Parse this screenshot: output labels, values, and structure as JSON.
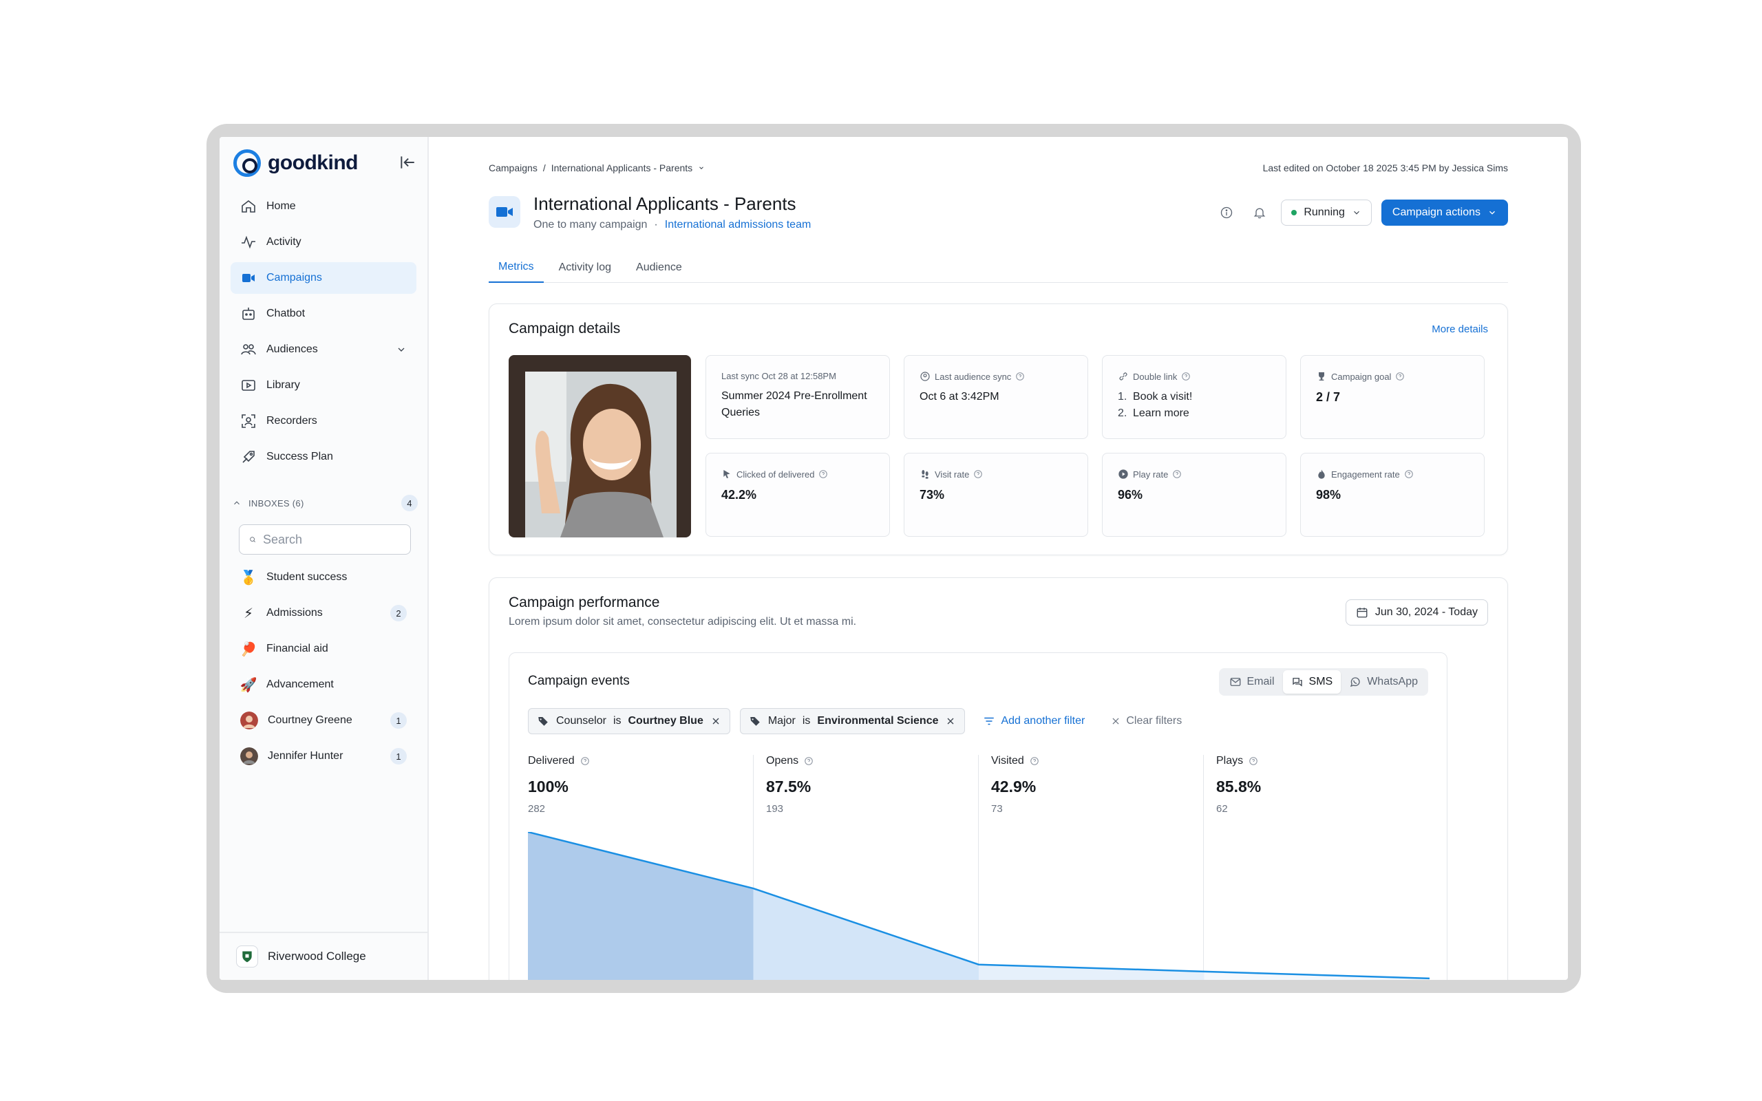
{
  "brand": {
    "name": "goodkind"
  },
  "sidebar": {
    "nav": [
      {
        "label": "Home",
        "icon": "home-icon"
      },
      {
        "label": "Activity",
        "icon": "activity-icon"
      },
      {
        "label": "Campaigns",
        "icon": "campaigns-icon",
        "active": true
      },
      {
        "label": "Chatbot",
        "icon": "chatbot-icon"
      },
      {
        "label": "Audiences",
        "icon": "audiences-icon",
        "expandable": true
      },
      {
        "label": "Library",
        "icon": "library-icon"
      },
      {
        "label": "Recorders",
        "icon": "recorders-icon"
      },
      {
        "label": "Success Plan",
        "icon": "success-plan-icon"
      }
    ],
    "inboxes_header": "INBOXES (6)",
    "inboxes_count": "4",
    "search_placeholder": "Search",
    "inboxes": [
      {
        "label": "Student success",
        "icon": "medal-icon",
        "count": ""
      },
      {
        "label": "Admissions",
        "icon": "lightning-icon",
        "count": "2"
      },
      {
        "label": "Financial aid",
        "icon": "ping-pong-icon",
        "count": ""
      },
      {
        "label": "Advancement",
        "icon": "rocket-icon",
        "count": ""
      },
      {
        "label": "Courtney Greene",
        "icon": "avatar",
        "count": "1"
      },
      {
        "label": "Jennifer Hunter",
        "icon": "avatar",
        "count": "1"
      }
    ],
    "org": "Riverwood College"
  },
  "breadcrumb": {
    "root": "Campaigns",
    "separator": "/",
    "current": "International Applicants - Parents"
  },
  "last_edited": "Last edited on October 18 2025 3:45 PM by Jessica Sims",
  "campaign": {
    "title": "International Applicants - Parents",
    "type": "One to many campaign",
    "separator": "·",
    "team": "International admissions team",
    "status": "Running",
    "status_color": "#1fa463",
    "actions_label": "Campaign actions"
  },
  "tabs": [
    "Metrics",
    "Activity log",
    "Audience"
  ],
  "details": {
    "title": "Campaign details",
    "more": "More details",
    "tiles": {
      "last_sync_label": "Last sync Oct 28 at 12:58PM",
      "last_sync_value": "Summer 2024 Pre-Enrollment Queries",
      "audience_sync_label": "Last audience sync",
      "audience_sync_value": "Oct 6 at 3:42PM",
      "double_link_label": "Double link",
      "double_link_items": [
        "Book a visit!",
        "Learn more"
      ],
      "goal_label": "Campaign goal",
      "goal_value": "2 / 7",
      "clicked_label": "Clicked of delivered",
      "clicked_value": "42.2%",
      "visit_label": "Visit rate",
      "visit_value": "73%",
      "play_label": "Play rate",
      "play_value": "96%",
      "engagement_label": "Engagement rate",
      "engagement_value": "98%"
    }
  },
  "performance": {
    "title": "Campaign performance",
    "subtitle": "Lorem ipsum dolor sit amet, consectetur adipiscing elit. Ut et massa mi.",
    "date_range": "Jun 30, 2024 - Today",
    "events_title": "Campaign events",
    "channels": [
      {
        "label": "Email",
        "icon": "mail-icon"
      },
      {
        "label": "SMS",
        "icon": "chat-icon",
        "active": true
      },
      {
        "label": "WhatsApp",
        "icon": "whatsapp-icon"
      }
    ],
    "filters": [
      {
        "field": "Counselor",
        "op": "is",
        "value": "Courtney Blue"
      },
      {
        "field": "Major",
        "op": "is",
        "value": "Environmental Science"
      }
    ],
    "add_filter": "Add another filter",
    "clear_filters": "Clear filters"
  },
  "chart_data": {
    "type": "area",
    "categories": [
      "Delivered",
      "Opens",
      "Visited",
      "Plays"
    ],
    "series": [
      {
        "values": [
          100,
          87.5,
          42.9,
          85.8
        ]
      }
    ],
    "counts": [
      282,
      193,
      73,
      62
    ],
    "display_values": [
      "100%",
      "87.5%",
      "42.9%",
      "85.8%"
    ],
    "colors": {
      "line": "#1a8fe3",
      "fills": [
        "#aecbeb",
        "#d3e5f8",
        "#e6f0fb",
        "#f4f8fd"
      ]
    }
  }
}
